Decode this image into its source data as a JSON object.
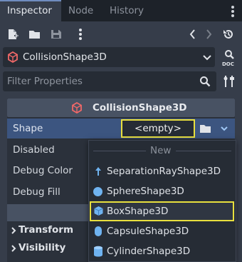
{
  "tabs": [
    {
      "label": "Inspector",
      "active": true
    },
    {
      "label": "Node",
      "active": false
    },
    {
      "label": "History",
      "active": false
    }
  ],
  "toolbar": {
    "icons": [
      "new-resource-icon",
      "open-folder-icon",
      "save-icon",
      "more-icon",
      "back-arrow-icon",
      "forward-arrow-icon",
      "history-icon"
    ]
  },
  "node_selector": {
    "name": "CollisionShape3D",
    "doc_label": "DOC"
  },
  "filter": {
    "placeholder": "Filter Properties"
  },
  "inspector": {
    "header_title": "CollisionShape3D",
    "properties": [
      {
        "label": "Shape",
        "value": "<empty>"
      },
      {
        "label": "Disabled"
      },
      {
        "label": "Debug Color"
      },
      {
        "label": "Debug Fill"
      }
    ],
    "sections": [
      "Transform",
      "Visibility"
    ]
  },
  "popup": {
    "separator_label": "New",
    "items": [
      {
        "label": "SeparationRayShape3D",
        "icon": "separation-ray-icon",
        "selected": false
      },
      {
        "label": "SphereShape3D",
        "icon": "sphere-icon",
        "selected": false
      },
      {
        "label": "BoxShape3D",
        "icon": "box-icon",
        "selected": true
      },
      {
        "label": "CapsuleShape3D",
        "icon": "capsule-icon",
        "selected": false
      },
      {
        "label": "CylinderShape3D",
        "icon": "cylinder-icon",
        "selected": false
      }
    ]
  },
  "colors": {
    "accent_highlight": "#e8df3e",
    "shape_icon_blue": "#6fb3f0",
    "node_icon_red": "#f06868"
  }
}
